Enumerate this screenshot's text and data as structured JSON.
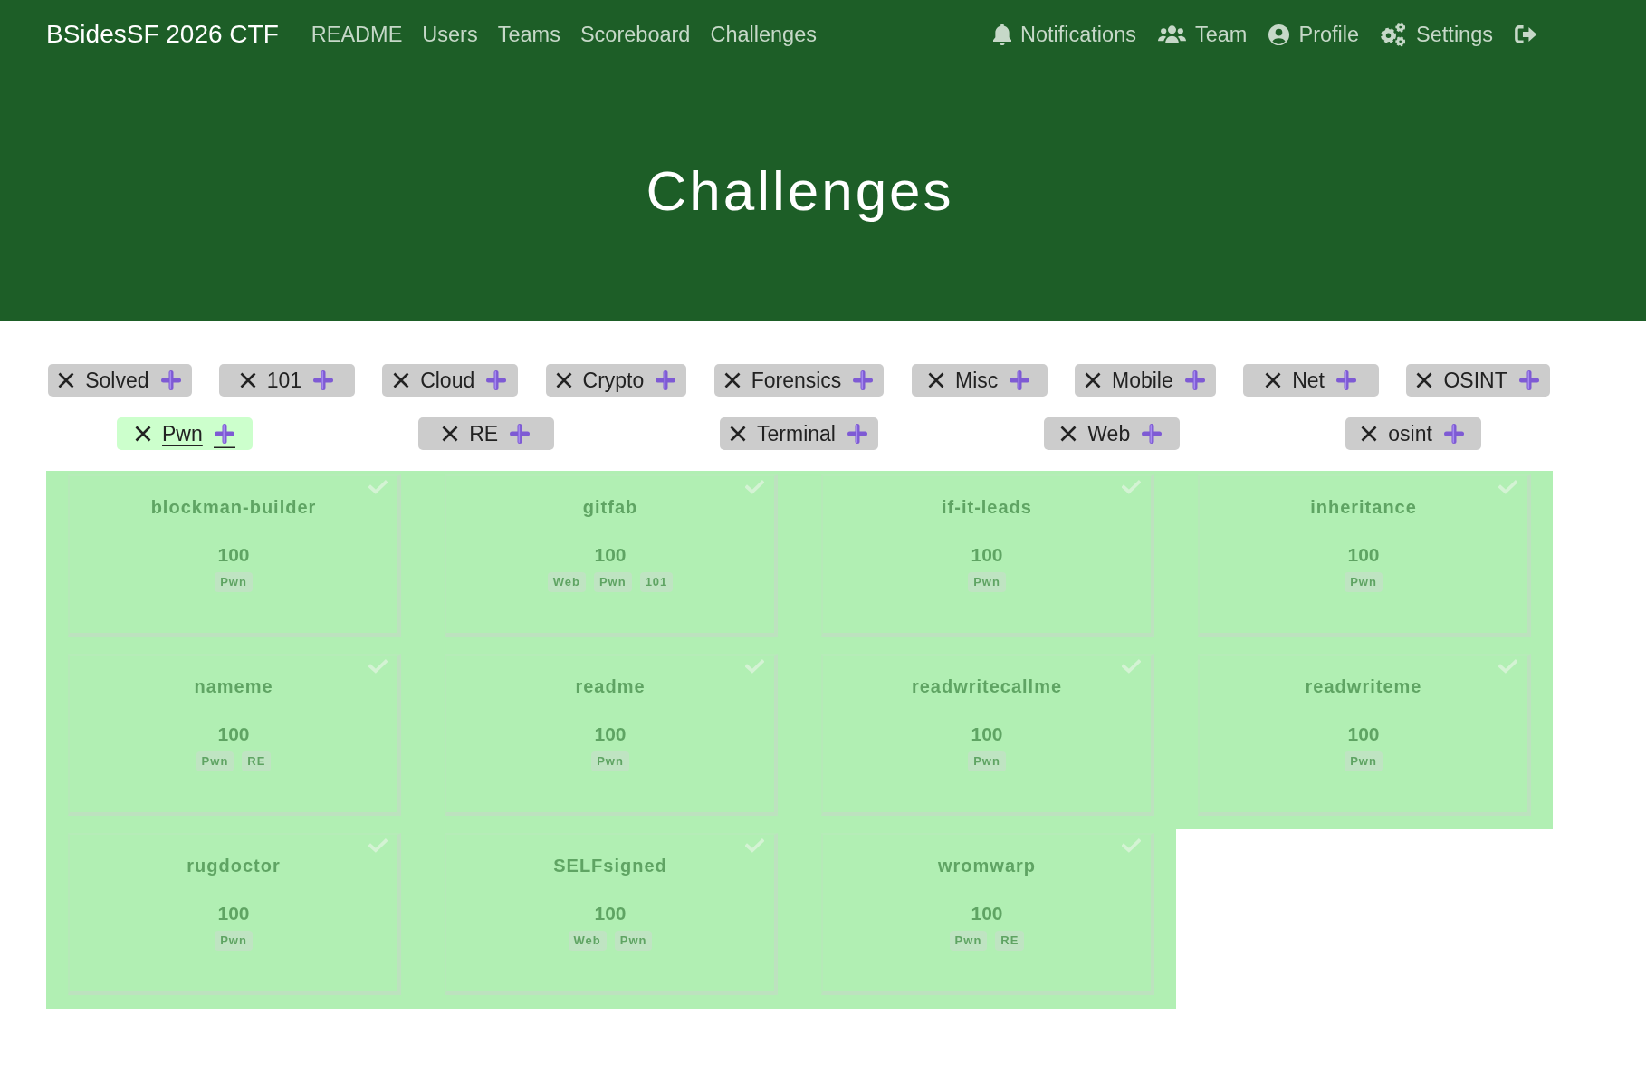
{
  "navbar": {
    "brand": "BSidesSF 2026 CTF",
    "links": [
      {
        "label": "README"
      },
      {
        "label": "Users"
      },
      {
        "label": "Teams"
      },
      {
        "label": "Scoreboard"
      },
      {
        "label": "Challenges"
      }
    ],
    "user_links": [
      {
        "kind": "notifications",
        "label": "Notifications"
      },
      {
        "kind": "team",
        "label": "Team"
      },
      {
        "kind": "profile",
        "label": "Profile"
      },
      {
        "kind": "settings",
        "label": "Settings"
      },
      {
        "kind": "logout"
      }
    ]
  },
  "hero": {
    "title": "Challenges"
  },
  "filter_rows": [
    [
      {
        "label": "Solved",
        "selected": false
      },
      {
        "label": "101",
        "selected": false
      },
      {
        "label": "Cloud",
        "selected": false
      },
      {
        "label": "Crypto",
        "selected": false
      },
      {
        "label": "Forensics",
        "selected": false
      },
      {
        "label": "Misc",
        "selected": false
      },
      {
        "label": "Mobile",
        "selected": false
      },
      {
        "label": "Net",
        "selected": false
      },
      {
        "label": "OSINT",
        "selected": false
      }
    ],
    [
      {
        "label": "Pwn",
        "selected": true
      },
      {
        "label": "RE",
        "selected": false
      },
      {
        "label": "Terminal",
        "selected": false
      },
      {
        "label": "Web",
        "selected": false
      },
      {
        "label": "osint",
        "selected": false
      }
    ]
  ],
  "challenges": [
    {
      "name": "blockman-builder",
      "points": "100",
      "tags": [
        "Pwn"
      ],
      "solved": true
    },
    {
      "name": "gitfab",
      "points": "100",
      "tags": [
        "Web",
        "Pwn",
        "101"
      ],
      "solved": true
    },
    {
      "name": "if-it-leads",
      "points": "100",
      "tags": [
        "Pwn"
      ],
      "solved": true
    },
    {
      "name": "inheritance",
      "points": "100",
      "tags": [
        "Pwn"
      ],
      "solved": true
    },
    {
      "name": "nameme",
      "points": "100",
      "tags": [
        "Pwn",
        "RE"
      ],
      "solved": true
    },
    {
      "name": "readme",
      "points": "100",
      "tags": [
        "Pwn"
      ],
      "solved": true
    },
    {
      "name": "readwritecallme",
      "points": "100",
      "tags": [
        "Pwn"
      ],
      "solved": true
    },
    {
      "name": "readwriteme",
      "points": "100",
      "tags": [
        "Pwn"
      ],
      "solved": true
    },
    {
      "name": "rugdoctor",
      "points": "100",
      "tags": [
        "Pwn"
      ],
      "solved": true
    },
    {
      "name": "SELFsigned",
      "points": "100",
      "tags": [
        "Web",
        "Pwn"
      ],
      "solved": true
    },
    {
      "name": "wromwarp",
      "points": "100",
      "tags": [
        "Pwn",
        "RE"
      ],
      "solved": true
    }
  ]
}
